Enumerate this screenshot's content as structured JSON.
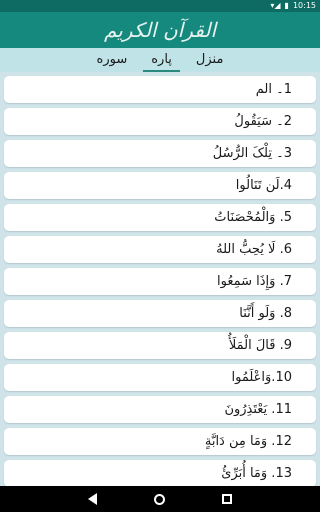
{
  "status_bar": {
    "time": "10:15",
    "signal_icon": "signal-icon",
    "battery_icon": "battery-icon"
  },
  "app_bar": {
    "title": "القرآن الکریم"
  },
  "tabs": [
    {
      "label": "منزل",
      "active": false
    },
    {
      "label": "پاره",
      "active": true
    },
    {
      "label": "سوره",
      "active": false
    }
  ],
  "paras": [
    {
      "text": "1۔ الم"
    },
    {
      "text": "2۔ سَیَقُولُ"
    },
    {
      "text": "3۔ تِلْکَ الرُّسُلُ"
    },
    {
      "text": "4.لَن تَنَالُوا"
    },
    {
      "text": "5. وَالْمُحْصَنَاتُ"
    },
    {
      "text": "6. لَا یُحِبُّ اللهُ"
    },
    {
      "text": "7. وَإِذَا سَمِعُوا"
    },
    {
      "text": "8. وَلَو أَنَّنَا"
    },
    {
      "text": "9. قَالَ الْمَلَأُ"
    },
    {
      "text": "10.وَاعْلَمُوا"
    },
    {
      "text": "11. یَعْتَذِرُونَ"
    },
    {
      "text": "12. وَمَا مِن دَابَّةٍ"
    },
    {
      "text": "13. وَمَا أُبَرِّئُ"
    }
  ],
  "nav": {
    "back_icon": "back-icon",
    "home_icon": "home-icon",
    "recents_icon": "recents-icon"
  }
}
